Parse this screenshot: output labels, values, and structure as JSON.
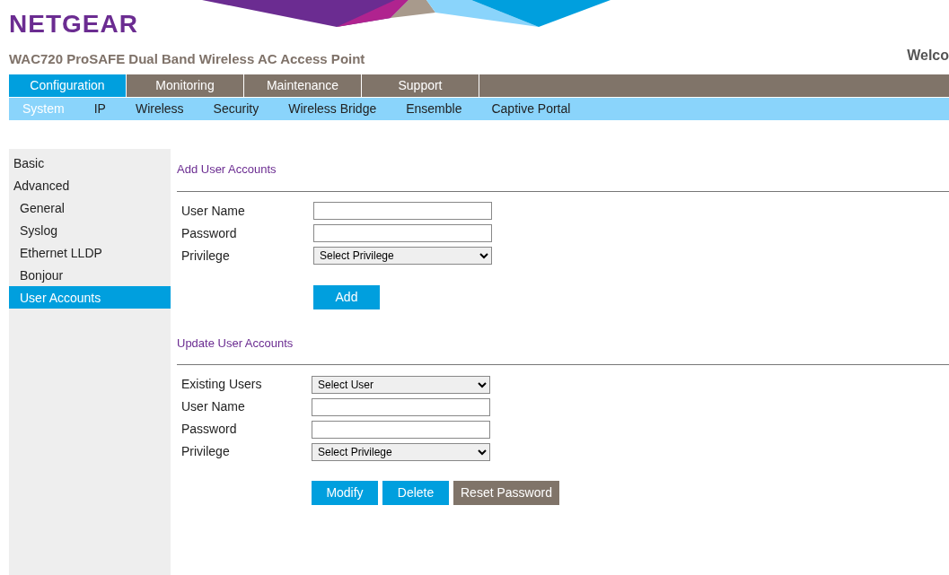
{
  "header": {
    "logo": "NETGEAR",
    "product_title": "WAC720 ProSAFE Dual Band Wireless AC Access Point",
    "welcome": "Welco"
  },
  "main_tabs": [
    {
      "label": "Configuration",
      "selected": true
    },
    {
      "label": "Monitoring",
      "selected": false
    },
    {
      "label": "Maintenance",
      "selected": false
    },
    {
      "label": "Support",
      "selected": false
    }
  ],
  "sub_tabs": [
    {
      "label": "System",
      "selected": true
    },
    {
      "label": "IP",
      "selected": false
    },
    {
      "label": "Wireless",
      "selected": false
    },
    {
      "label": "Security",
      "selected": false
    },
    {
      "label": "Wireless Bridge",
      "selected": false
    },
    {
      "label": "Ensemble",
      "selected": false
    },
    {
      "label": "Captive Portal",
      "selected": false
    }
  ],
  "sidebar": {
    "items": [
      {
        "label": "Basic",
        "selected": false
      },
      {
        "label": "Advanced",
        "selected": false,
        "children": [
          {
            "label": "General",
            "selected": false
          },
          {
            "label": "Syslog",
            "selected": false
          },
          {
            "label": "Ethernet LLDP",
            "selected": false
          },
          {
            "label": "Bonjour",
            "selected": false
          },
          {
            "label": "User Accounts",
            "selected": true
          }
        ]
      }
    ]
  },
  "sections": [
    {
      "title": "Add User Accounts",
      "fields": [
        {
          "label": "User Name",
          "kind": "text"
        },
        {
          "label": "Password",
          "kind": "password"
        },
        {
          "label": "Privilege",
          "kind": "select",
          "value": "Select Privilege"
        }
      ],
      "buttons": [
        {
          "label": "Add",
          "kind": "primary"
        }
      ]
    },
    {
      "title": "Update User Accounts",
      "fields": [
        {
          "label": "Existing Users",
          "kind": "select",
          "value": "Select User"
        },
        {
          "label": "User Name",
          "kind": "text"
        },
        {
          "label": "Password",
          "kind": "password"
        },
        {
          "label": "Privilege",
          "kind": "select",
          "value": "Select Privilege"
        }
      ],
      "buttons": [
        {
          "label": "Modify",
          "kind": "primary"
        },
        {
          "label": "Delete",
          "kind": "primary"
        },
        {
          "label": "Reset Password",
          "kind": "secondary"
        }
      ]
    }
  ]
}
